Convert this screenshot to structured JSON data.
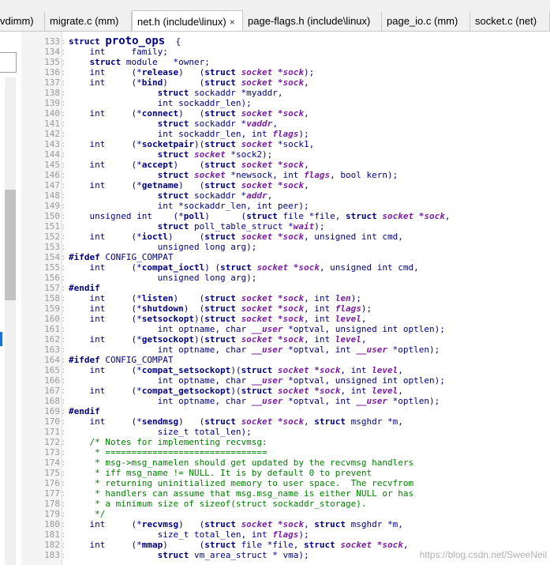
{
  "tabs": [
    {
      "label": "vdimm)",
      "active": false
    },
    {
      "label": "migrate.c (mm)",
      "active": false
    },
    {
      "label": "net.h (include\\linux)",
      "active": true,
      "close": "×"
    },
    {
      "label": "page-flags.h (include\\linux)",
      "active": false
    },
    {
      "label": "page_io.c (mm)",
      "active": false
    },
    {
      "label": "socket.c (net)",
      "active": false
    }
  ],
  "watermark": "https://blog.csdn.net/SweeNeil",
  "lines": [
    {
      "n": "133",
      "segs": [
        [
          "kw",
          "struct "
        ],
        [
          "fn big",
          "proto_ops"
        ],
        [
          "",
          "  {"
        ]
      ]
    },
    {
      "n": "134",
      "segs": [
        [
          "",
          "    int     family;"
        ]
      ]
    },
    {
      "n": "135",
      "segs": [
        [
          "",
          "    "
        ],
        [
          "kw",
          "struct "
        ],
        [
          "",
          "module   *owner;"
        ]
      ]
    },
    {
      "n": "136",
      "segs": [
        [
          "",
          "    int     (*"
        ],
        [
          "fn",
          "release"
        ],
        [
          "",
          ")   ("
        ],
        [
          "kw",
          "struct "
        ],
        [
          "pa",
          "socket *sock"
        ],
        [
          "",
          ");"
        ]
      ]
    },
    {
      "n": "137",
      "segs": [
        [
          "",
          "    int     (*"
        ],
        [
          "fn",
          "bind"
        ],
        [
          "",
          ")      ("
        ],
        [
          "kw",
          "struct "
        ],
        [
          "pa",
          "socket *sock"
        ],
        [
          "",
          ","
        ]
      ]
    },
    {
      "n": "138",
      "segs": [
        [
          "",
          "                 "
        ],
        [
          "kw",
          "struct "
        ],
        [
          "",
          "sockaddr *myaddr,"
        ]
      ]
    },
    {
      "n": "139",
      "segs": [
        [
          "",
          "                 int sockaddr_len);"
        ]
      ]
    },
    {
      "n": "140",
      "segs": [
        [
          "",
          "    int     (*"
        ],
        [
          "fn",
          "connect"
        ],
        [
          "",
          ")   ("
        ],
        [
          "kw",
          "struct "
        ],
        [
          "pa",
          "socket *sock"
        ],
        [
          "",
          ","
        ]
      ]
    },
    {
      "n": "141",
      "segs": [
        [
          "",
          "                 "
        ],
        [
          "kw",
          "struct "
        ],
        [
          "",
          "sockaddr *"
        ],
        [
          "pa",
          "vaddr"
        ],
        [
          "",
          ","
        ]
      ]
    },
    {
      "n": "142",
      "segs": [
        [
          "",
          "                 int sockaddr_len, int "
        ],
        [
          "pa",
          "flags"
        ],
        [
          "",
          ");"
        ]
      ]
    },
    {
      "n": "143",
      "segs": [
        [
          "",
          "    int     (*"
        ],
        [
          "fn",
          "socketpair"
        ],
        [
          "",
          ")("
        ],
        [
          "kw",
          "struct "
        ],
        [
          "pa",
          "socket"
        ],
        [
          "",
          " *sock1,"
        ]
      ]
    },
    {
      "n": "144",
      "segs": [
        [
          "",
          "                 "
        ],
        [
          "kw",
          "struct "
        ],
        [
          "pa",
          "socket"
        ],
        [
          "",
          " *sock2);"
        ]
      ]
    },
    {
      "n": "145",
      "segs": [
        [
          "",
          "    int     (*"
        ],
        [
          "fn",
          "accept"
        ],
        [
          "",
          ")    ("
        ],
        [
          "kw",
          "struct "
        ],
        [
          "pa",
          "socket *sock"
        ],
        [
          "",
          ","
        ]
      ]
    },
    {
      "n": "146",
      "segs": [
        [
          "",
          "                 "
        ],
        [
          "kw",
          "struct "
        ],
        [
          "pa",
          "socket"
        ],
        [
          "",
          " *newsock, int "
        ],
        [
          "pa",
          "flags"
        ],
        [
          "",
          ", bool kern);"
        ]
      ]
    },
    {
      "n": "147",
      "segs": [
        [
          "",
          "    int     (*"
        ],
        [
          "fn",
          "getname"
        ],
        [
          "",
          ")   ("
        ],
        [
          "kw",
          "struct "
        ],
        [
          "pa",
          "socket *sock"
        ],
        [
          "",
          ","
        ]
      ]
    },
    {
      "n": "148",
      "segs": [
        [
          "",
          "                 "
        ],
        [
          "kw",
          "struct "
        ],
        [
          "",
          "sockaddr *"
        ],
        [
          "pa",
          "addr"
        ],
        [
          "",
          ","
        ]
      ]
    },
    {
      "n": "149",
      "segs": [
        [
          "",
          "                 int *sockaddr_len, int peer);"
        ]
      ]
    },
    {
      "n": "150",
      "segs": [
        [
          "",
          "    unsigned int    (*"
        ],
        [
          "fn",
          "poll"
        ],
        [
          "",
          ")      ("
        ],
        [
          "kw",
          "struct "
        ],
        [
          "",
          "file *file, "
        ],
        [
          "kw",
          "struct "
        ],
        [
          "pa",
          "socket *sock"
        ],
        [
          "",
          ","
        ]
      ]
    },
    {
      "n": "151",
      "segs": [
        [
          "",
          "                 "
        ],
        [
          "kw",
          "struct "
        ],
        [
          "",
          "poll_table_struct *"
        ],
        [
          "pa",
          "wait"
        ],
        [
          "",
          ");"
        ]
      ]
    },
    {
      "n": "152",
      "segs": [
        [
          "",
          "    int     (*"
        ],
        [
          "fn",
          "ioctl"
        ],
        [
          "",
          ")     ("
        ],
        [
          "kw",
          "struct "
        ],
        [
          "pa",
          "socket *sock"
        ],
        [
          "",
          ", unsigned int cmd,"
        ]
      ]
    },
    {
      "n": "153",
      "segs": [
        [
          "",
          "                 unsigned long arg);"
        ]
      ]
    },
    {
      "n": "154",
      "segs": [
        [
          "pp",
          "#ifdef "
        ],
        [
          "",
          "CONFIG_COMPAT"
        ]
      ]
    },
    {
      "n": "155",
      "segs": [
        [
          "",
          "    int     (*"
        ],
        [
          "fn",
          "compat_ioctl"
        ],
        [
          "",
          ") ("
        ],
        [
          "kw",
          "struct "
        ],
        [
          "pa",
          "socket *sock"
        ],
        [
          "",
          ", unsigned int cmd,"
        ]
      ]
    },
    {
      "n": "156",
      "segs": [
        [
          "",
          "                 unsigned long arg);"
        ]
      ]
    },
    {
      "n": "157",
      "segs": [
        [
          "pp",
          "#endif"
        ]
      ]
    },
    {
      "n": "158",
      "segs": [
        [
          "",
          "    int     (*"
        ],
        [
          "fn",
          "listen"
        ],
        [
          "",
          ")    ("
        ],
        [
          "kw",
          "struct "
        ],
        [
          "pa",
          "socket *sock"
        ],
        [
          "",
          ", int "
        ],
        [
          "pa",
          "len"
        ],
        [
          "",
          ");"
        ]
      ]
    },
    {
      "n": "159",
      "segs": [
        [
          "",
          "    int     (*"
        ],
        [
          "fn",
          "shutdown"
        ],
        [
          "",
          ")  ("
        ],
        [
          "kw",
          "struct "
        ],
        [
          "pa",
          "socket *sock"
        ],
        [
          "",
          ", int "
        ],
        [
          "pa",
          "flags"
        ],
        [
          "",
          ");"
        ]
      ]
    },
    {
      "n": "160",
      "segs": [
        [
          "",
          "    int     (*"
        ],
        [
          "fn",
          "setsockopt"
        ],
        [
          "",
          ")("
        ],
        [
          "kw",
          "struct "
        ],
        [
          "pa",
          "socket *sock"
        ],
        [
          "",
          ", int "
        ],
        [
          "pa",
          "level"
        ],
        [
          "",
          ","
        ]
      ]
    },
    {
      "n": "161",
      "segs": [
        [
          "",
          "                 int optname, char "
        ],
        [
          "pa",
          "__user"
        ],
        [
          "",
          " *optval, unsigned int optlen);"
        ]
      ]
    },
    {
      "n": "162",
      "segs": [
        [
          "",
          "    int     (*"
        ],
        [
          "fn",
          "getsockopt"
        ],
        [
          "",
          ")("
        ],
        [
          "kw",
          "struct "
        ],
        [
          "pa",
          "socket *sock"
        ],
        [
          "",
          ", int "
        ],
        [
          "pa",
          "level"
        ],
        [
          "",
          ","
        ]
      ]
    },
    {
      "n": "163",
      "segs": [
        [
          "",
          "                 int optname, char "
        ],
        [
          "pa",
          "__user"
        ],
        [
          "",
          " *optval, int "
        ],
        [
          "pa",
          "__user"
        ],
        [
          "",
          " *optlen);"
        ]
      ]
    },
    {
      "n": "164",
      "segs": [
        [
          "pp",
          "#ifdef "
        ],
        [
          "",
          "CONFIG_COMPAT"
        ]
      ]
    },
    {
      "n": "165",
      "segs": [
        [
          "",
          "    int     (*"
        ],
        [
          "fn",
          "compat_setsockopt"
        ],
        [
          "",
          ")("
        ],
        [
          "kw",
          "struct "
        ],
        [
          "pa",
          "socket *sock"
        ],
        [
          "",
          ", int "
        ],
        [
          "pa",
          "level"
        ],
        [
          "",
          ","
        ]
      ]
    },
    {
      "n": "166",
      "segs": [
        [
          "",
          "                 int optname, char "
        ],
        [
          "pa",
          "__user"
        ],
        [
          "",
          " *optval, unsigned int optlen);"
        ]
      ]
    },
    {
      "n": "167",
      "segs": [
        [
          "",
          "    int     (*"
        ],
        [
          "fn",
          "compat_getsockopt"
        ],
        [
          "",
          ")("
        ],
        [
          "kw",
          "struct "
        ],
        [
          "pa",
          "socket *sock"
        ],
        [
          "",
          ", int "
        ],
        [
          "pa",
          "level"
        ],
        [
          "",
          ","
        ]
      ]
    },
    {
      "n": "168",
      "segs": [
        [
          "",
          "                 int optname, char "
        ],
        [
          "pa",
          "__user"
        ],
        [
          "",
          " *optval, int "
        ],
        [
          "pa",
          "__user"
        ],
        [
          "",
          " *optlen);"
        ]
      ]
    },
    {
      "n": "169",
      "segs": [
        [
          "pp",
          "#endif"
        ]
      ]
    },
    {
      "n": "170",
      "segs": [
        [
          "",
          "    int     (*"
        ],
        [
          "fn",
          "sendmsg"
        ],
        [
          "",
          ")   ("
        ],
        [
          "kw",
          "struct "
        ],
        [
          "pa",
          "socket *sock"
        ],
        [
          "",
          ", "
        ],
        [
          "kw",
          "struct "
        ],
        [
          "",
          "msghdr *m,"
        ]
      ]
    },
    {
      "n": "171",
      "segs": [
        [
          "",
          "                 size_t total_len);"
        ]
      ]
    },
    {
      "n": "172",
      "segs": [
        [
          "cm",
          "    /* Notes for implementing recvmsg:"
        ]
      ]
    },
    {
      "n": "173",
      "segs": [
        [
          "cm",
          "     * ==============================="
        ]
      ]
    },
    {
      "n": "174",
      "segs": [
        [
          "cm",
          "     * msg->msg_namelen should get updated by the recvmsg handlers"
        ]
      ]
    },
    {
      "n": "175",
      "segs": [
        [
          "cm",
          "     * iff msg_name != NULL. It is by default 0 to prevent"
        ]
      ]
    },
    {
      "n": "176",
      "segs": [
        [
          "cm",
          "     * returning uninitialized memory to user space.  The recvfrom"
        ]
      ]
    },
    {
      "n": "177",
      "segs": [
        [
          "cm",
          "     * handlers can assume that msg.msg_name is either NULL or has"
        ]
      ]
    },
    {
      "n": "178",
      "segs": [
        [
          "cm",
          "     * a minimum size of sizeof(struct sockaddr_storage)."
        ]
      ]
    },
    {
      "n": "179",
      "segs": [
        [
          "cm",
          "     */"
        ]
      ]
    },
    {
      "n": "180",
      "segs": [
        [
          "",
          "    int     (*"
        ],
        [
          "fn",
          "recvmsg"
        ],
        [
          "",
          ")   ("
        ],
        [
          "kw",
          "struct "
        ],
        [
          "pa",
          "socket *sock"
        ],
        [
          "",
          ", "
        ],
        [
          "kw",
          "struct "
        ],
        [
          "",
          "msghdr *m,"
        ]
      ]
    },
    {
      "n": "181",
      "segs": [
        [
          "",
          "                 size_t total_len, int "
        ],
        [
          "pa",
          "flags"
        ],
        [
          "",
          ");"
        ]
      ]
    },
    {
      "n": "182",
      "segs": [
        [
          "",
          "    int     (*"
        ],
        [
          "fn",
          "mmap"
        ],
        [
          "",
          ")      ("
        ],
        [
          "kw",
          "struct "
        ],
        [
          "",
          "file *file, "
        ],
        [
          "kw",
          "struct "
        ],
        [
          "pa",
          "socket *sock"
        ],
        [
          "",
          ","
        ]
      ]
    },
    {
      "n": "183",
      "segs": [
        [
          "",
          "                 "
        ],
        [
          "kw",
          "struct "
        ],
        [
          "",
          "vm_area_struct * vma);"
        ]
      ]
    }
  ]
}
